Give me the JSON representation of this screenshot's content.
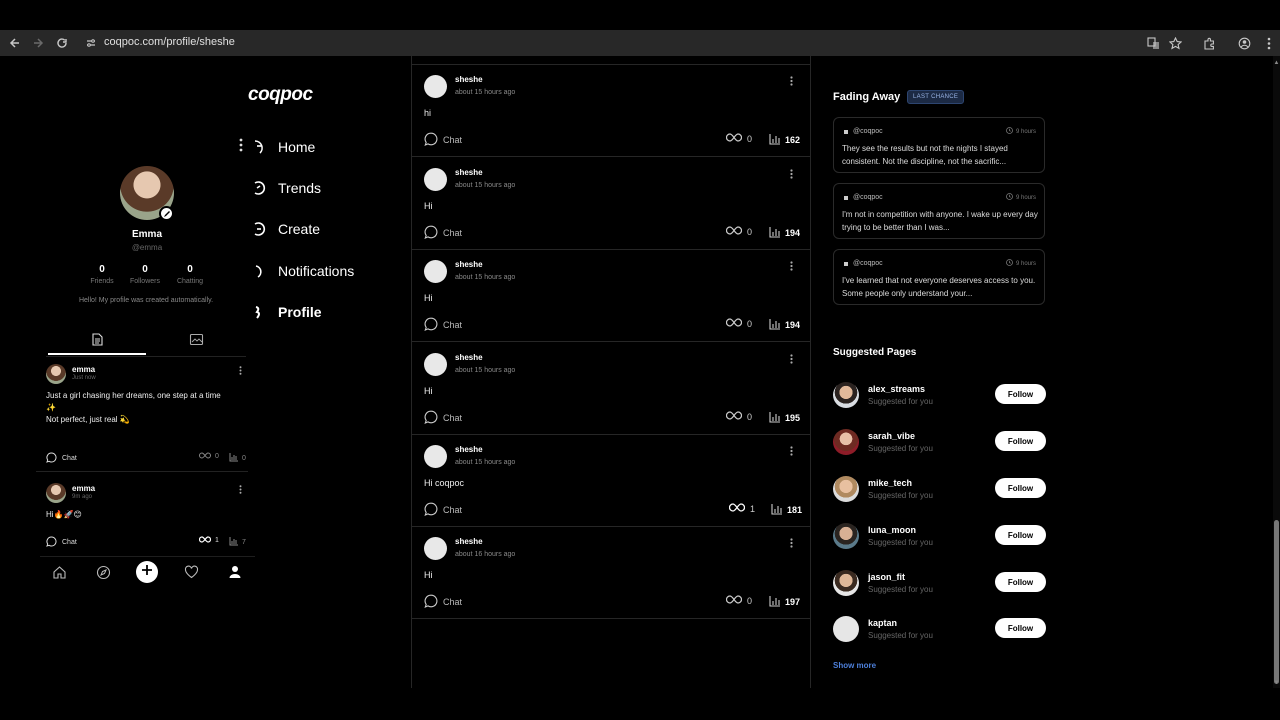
{
  "browser": {
    "url": "coqpoc.com/profile/sheshe"
  },
  "app": {
    "logo": "coqpoc"
  },
  "nav": {
    "items": [
      {
        "label": "Home",
        "icon": "home-icon"
      },
      {
        "label": "Trends",
        "icon": "trends-icon"
      },
      {
        "label": "Create",
        "icon": "create-icon"
      },
      {
        "label": "Notifications",
        "icon": "notifications-icon"
      },
      {
        "label": "Profile",
        "icon": "profile-icon",
        "active": true
      }
    ]
  },
  "profile": {
    "name": "Emma",
    "handle": "@emma",
    "stats": [
      {
        "value": "0",
        "label": "Friends"
      },
      {
        "value": "0",
        "label": "Followers"
      },
      {
        "value": "0",
        "label": "Chatting"
      }
    ],
    "bio": "Hello! My profile was created automatically."
  },
  "profile_posts": [
    {
      "name": "emma",
      "time": "Just now",
      "text": "Just a girl chasing her dreams, one step at a time\n✨\nNot perfect, just real 💫",
      "chat": "Chat",
      "reposts": "0",
      "views": "0"
    },
    {
      "name": "emma",
      "time": "9m ago",
      "text": "Hi🔥🚀😊",
      "chat": "Chat",
      "reposts": "1",
      "views": "7"
    }
  ],
  "feed": [
    {
      "name": "sheshe",
      "time": "about 15 hours ago",
      "text": "hi",
      "chat": "Chat",
      "reposts": "0",
      "views": "162"
    },
    {
      "name": "sheshe",
      "time": "about 15 hours ago",
      "text": "Hi",
      "chat": "Chat",
      "reposts": "0",
      "views": "194"
    },
    {
      "name": "sheshe",
      "time": "about 15 hours ago",
      "text": "Hi",
      "chat": "Chat",
      "reposts": "0",
      "views": "194"
    },
    {
      "name": "sheshe",
      "time": "about 15 hours ago",
      "text": "Hi",
      "chat": "Chat",
      "reposts": "0",
      "views": "195"
    },
    {
      "name": "sheshe",
      "time": "about 15 hours ago",
      "text": "Hi coqpoc",
      "chat": "Chat",
      "reposts": "1",
      "views": "181"
    },
    {
      "name": "sheshe",
      "time": "about 16 hours ago",
      "text": "Hi",
      "chat": "Chat",
      "reposts": "0",
      "views": "197"
    }
  ],
  "fading": {
    "title": "Fading Away",
    "badge": "LAST CHANCE",
    "cards": [
      {
        "handle": "@coqpoc",
        "time": "9 hours",
        "text": "They see the results but not the nights I stayed consistent. Not the discipline, not the sacrific..."
      },
      {
        "handle": "@coqpoc",
        "time": "9 hours",
        "text": "I'm not in competition with anyone. I wake up every day trying to be better than I was..."
      },
      {
        "handle": "@coqpoc",
        "time": "9 hours",
        "text": "I've learned that not everyone deserves access to you. Some people only understand your..."
      }
    ]
  },
  "suggested": {
    "title": "Suggested Pages",
    "items": [
      {
        "name": "alex_streams",
        "sub": "Suggested for you",
        "button": "Follow"
      },
      {
        "name": "sarah_vibe",
        "sub": "Suggested for you",
        "button": "Follow"
      },
      {
        "name": "mike_tech",
        "sub": "Suggested for you",
        "button": "Follow"
      },
      {
        "name": "luna_moon",
        "sub": "Suggested for you",
        "button": "Follow"
      },
      {
        "name": "jason_fit",
        "sub": "Suggested for you",
        "button": "Follow"
      },
      {
        "name": "kaptan",
        "sub": "Suggested for you",
        "button": "Follow"
      }
    ],
    "show_more": "Show more"
  }
}
